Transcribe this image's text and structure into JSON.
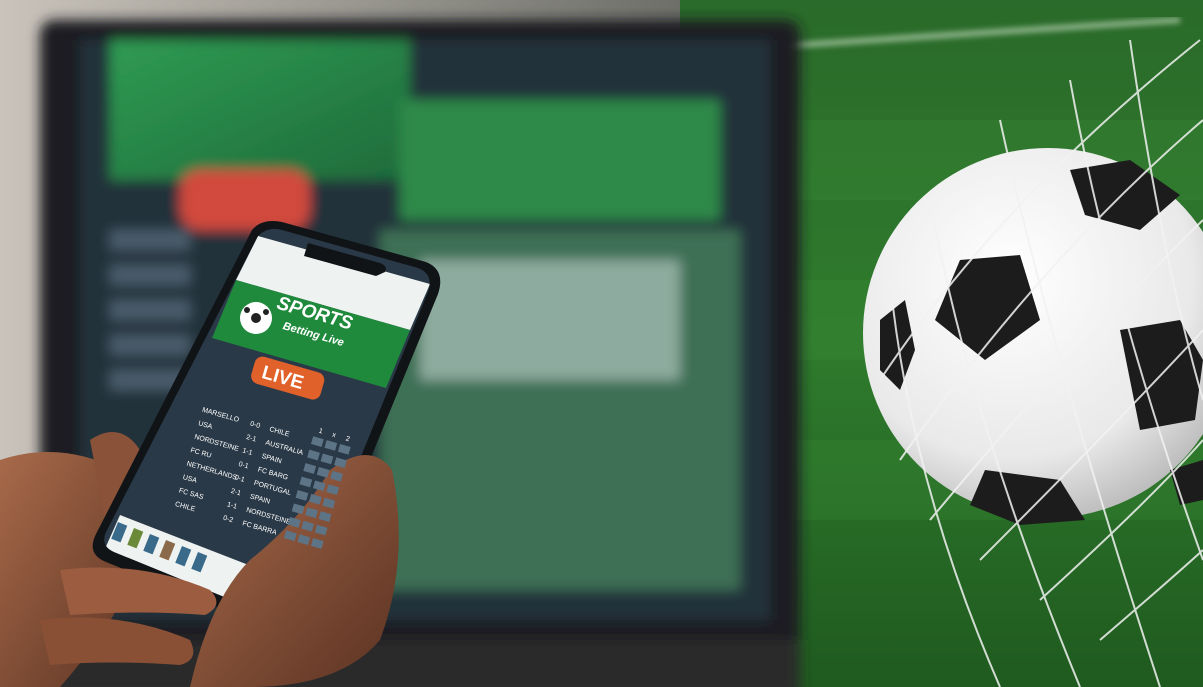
{
  "image": {
    "subject": "sports-betting-promo",
    "colors": {
      "grass": "#2f7a2c",
      "phone_green": "#1f8a3c",
      "live_orange": "#e0622a",
      "screen_dark": "#2a3947"
    }
  },
  "phone_app": {
    "brand_line1": "SPORTS",
    "brand_line2": "Betting Live",
    "live_badge": "LIVE",
    "columns": [
      "1",
      "x",
      "2"
    ],
    "matches": [
      {
        "home": "MARSELLO",
        "score": "0-0",
        "away": "CHILE"
      },
      {
        "home": "USA",
        "score": "2-1",
        "away": "AUSTRALIA"
      },
      {
        "home": "NORDSTEINE",
        "score": "1-1",
        "away": "SPAIN"
      },
      {
        "home": "FC RU",
        "score": "0-1",
        "away": "FC BARG"
      },
      {
        "home": "NETHERLANDS",
        "score": "0-1",
        "away": "PORTUGAL"
      },
      {
        "home": "USA",
        "score": "2-1",
        "away": "SPAIN"
      },
      {
        "home": "FC SAS",
        "score": "1-1",
        "away": "NORDSTEINE"
      },
      {
        "home": "CHILE",
        "score": "0-2",
        "away": "FC BARRA"
      }
    ]
  }
}
